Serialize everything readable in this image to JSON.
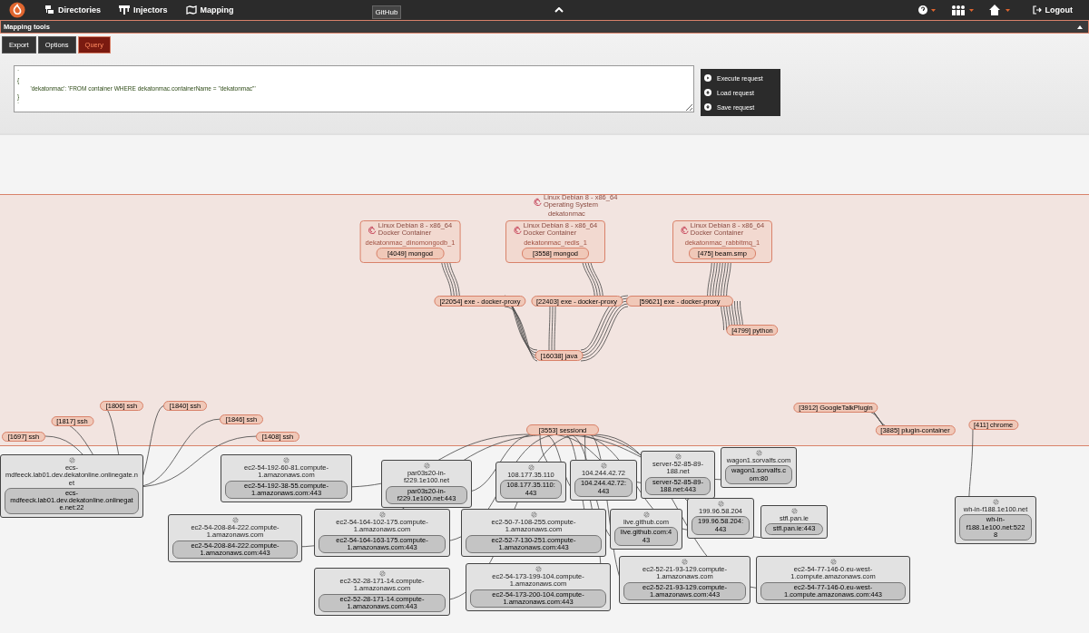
{
  "navbar": {
    "menu": [
      {
        "label": "Directories"
      },
      {
        "label": "Injectors"
      },
      {
        "label": "Mapping"
      }
    ],
    "github": "GitHub",
    "logout": "Logout"
  },
  "panel": {
    "title": "Mapping tools",
    "tabs": [
      {
        "label": "Export",
        "selected": false
      },
      {
        "label": "Options",
        "selected": false
      },
      {
        "label": "Query",
        "selected": true
      }
    ],
    "query": "`\n{\n        'dekatonmac': 'FROM container WHERE dekatonmac.containerName = \"dekatonmac\"'\n}\n`",
    "actions": [
      {
        "label": "Execute request"
      },
      {
        "label": "Load request"
      },
      {
        "label": "Save request"
      }
    ]
  },
  "graph": {
    "machine": {
      "os": "Linux Debian 8 - x86_64",
      "type": "Operating System",
      "name": "dekatonmac"
    },
    "containers": [
      {
        "os": "Linux Debian 8 - x86_64",
        "type": "Docker Container",
        "name": "dekatonmac_dinomongodb_1",
        "process": "[4049] mongod"
      },
      {
        "os": "Linux Debian 8 - x86_64",
        "type": "Docker Container",
        "name": "dekatonmac_redis_1",
        "process": "[3558] mongod"
      },
      {
        "os": "Linux Debian 8 - x86_64",
        "type": "Docker Container",
        "name": "dekatonmac_rabbitmq_1",
        "process": "[475] beam.smp"
      }
    ],
    "processes": [
      {
        "label": "[22054] exe - docker-proxy"
      },
      {
        "label": "[22403] exe - docker-proxy"
      },
      {
        "label": "[59621] exe - docker-proxy"
      },
      {
        "label": "[4799] python"
      },
      {
        "label": "[16038] java"
      },
      {
        "label": "[1697] ssh"
      },
      {
        "label": "[1817] ssh"
      },
      {
        "label": "[1806] ssh"
      },
      {
        "label": "[1840] ssh"
      },
      {
        "label": "[1846] ssh"
      },
      {
        "label": "[1408] ssh"
      },
      {
        "label": "[3553] sessiond"
      },
      {
        "label": "[3912] GoogleTalkPlugin"
      },
      {
        "label": "[3885] plugin-container"
      },
      {
        "label": "[411] chrome"
      }
    ],
    "hosts": [
      {
        "name": "ecs-mdfeeck.lab01.dev.dekatonline.onlinegate.net",
        "port": "ecs-mdfeeck.lab01.dev.dekatonline.onlinegate.net:22"
      },
      {
        "name": "ec2-54-192-60-81.compute-1.amazonaws.com",
        "port": "ec2-54-192-38-55.compute-1.amazonaws.com:443"
      },
      {
        "name": "par03s20-in-f229.1e100.net",
        "port": "par03s20-in-f229.1e100.net:443"
      },
      {
        "name": "108.177.35.110",
        "port": "108.177.35.110:443"
      },
      {
        "name": "104.244.42.72",
        "port": "104.244.42.72:443"
      },
      {
        "name": "server-52-85-89-188.net",
        "port": "server-52-85-89-188.net:443"
      },
      {
        "name": "wagon1.sorvalfs.com",
        "port": "wagon1.sorvalfs.com:80"
      },
      {
        "name": "ec2-54-208-84-222.compute-1.amazonaws.com",
        "port": "ec2-54-208-84-222.compute-1.amazonaws.com:443"
      },
      {
        "name": "ec2-54-164-102-175.compute-1.amazonaws.com",
        "port": "ec2-54-164-163-175.compute-1.amazonaws.com:443"
      },
      {
        "name": "ec2-50-7-108-255.compute-1.amazonaws.com",
        "port": "ec2-52-7-130-251.compute-1.amazonaws.com:443"
      },
      {
        "name": "live.github.com",
        "port": "live.github.com:443"
      },
      {
        "name": "199.96.58.204",
        "port": "199.96.58.204:443"
      },
      {
        "name": "stfl.pan.ie",
        "port": "stfl.pan.ie:443"
      },
      {
        "name": "wh-in-f188.1e100.net",
        "port": "wh-in-f188.1e100.net:5228"
      },
      {
        "name": "ec2-52-28-171-14.compute-1.amazonaws.com",
        "port": "ec2-52-28-171-14.compute-1.amazonaws.com:443"
      },
      {
        "name": "ec2-54-173-199-104.compute-1.amazonaws.com",
        "port": "ec2-54-173-200-104.compute-1.amazonaws.com:443"
      },
      {
        "name": "ec2-52-21-93-129.compute-1.amazonaws.com",
        "port": "ec2-52-21-93-129.compute-1.amazonaws.com:443"
      },
      {
        "name": "ec2-54-77-146-0.eu-west-1.compute.amazonaws.com",
        "port": "ec2-54-77-146-0.eu-west-1.compute.amazonaws.com:443"
      }
    ]
  }
}
